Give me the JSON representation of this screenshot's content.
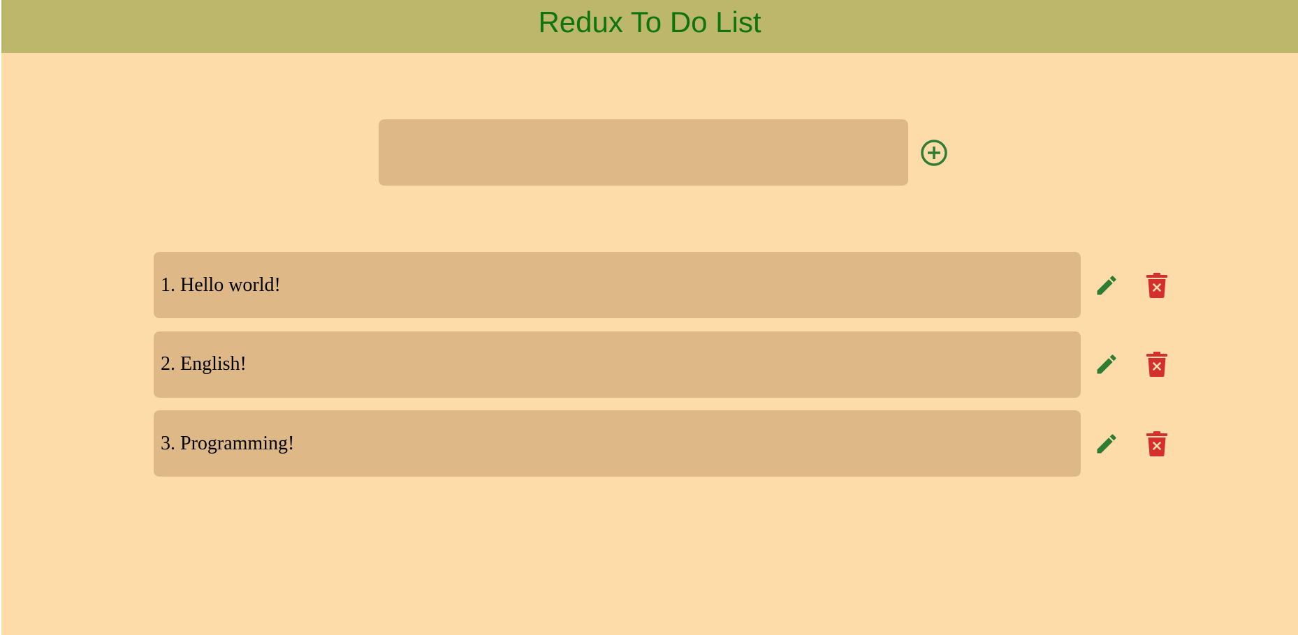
{
  "app": {
    "title": "Redux To Do List"
  },
  "add_form": {
    "input_value": "",
    "input_placeholder": "",
    "add_icon": "plus-circle-icon"
  },
  "todos": [
    {
      "label": "1. Hello world!",
      "edit_icon": "pencil-icon",
      "delete_icon": "trash-icon"
    },
    {
      "label": "2. English!",
      "edit_icon": "pencil-icon",
      "delete_icon": "trash-icon"
    },
    {
      "label": "3. Programming!",
      "edit_icon": "pencil-icon",
      "delete_icon": "trash-icon"
    }
  ],
  "colors": {
    "page_background": "#fedcaa",
    "header_background": "#bdb76b",
    "title_text": "#0f730f",
    "field_background": "#deb887",
    "edit_icon": "#2e7d32",
    "delete_icon": "#d32f2f",
    "add_icon": "#2e7d32"
  }
}
